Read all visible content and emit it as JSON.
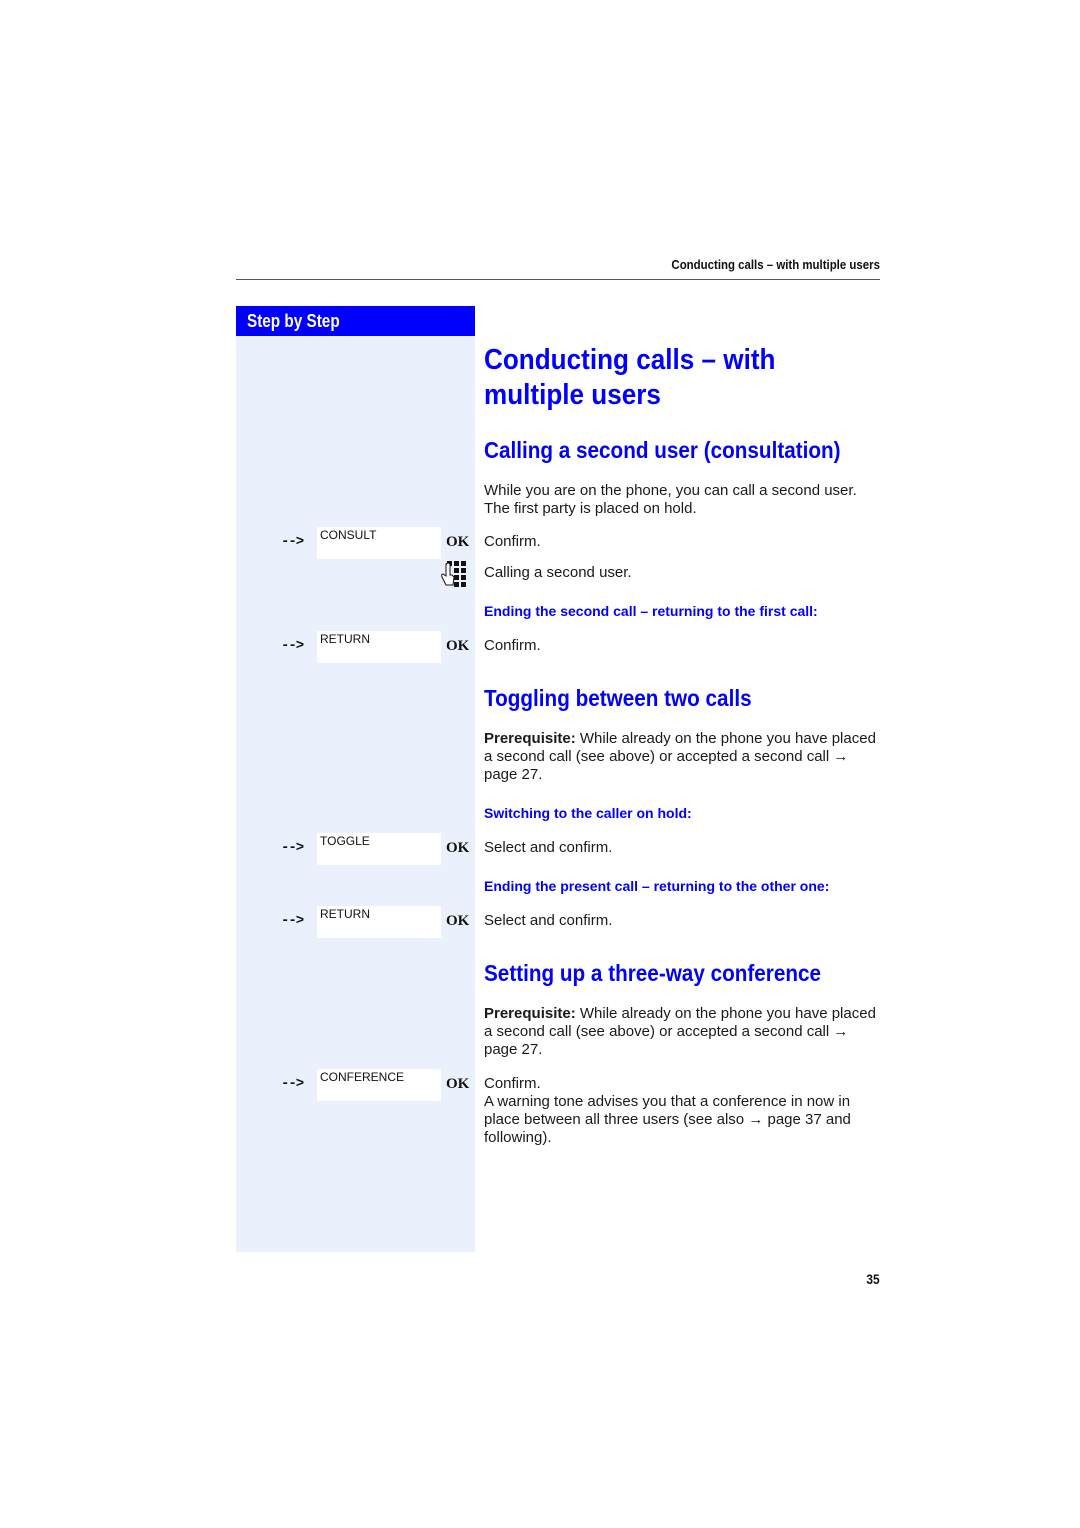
{
  "header": {
    "running_title": "Conducting calls – with multiple users"
  },
  "sidebar": {
    "title": "Step by Step"
  },
  "main": {
    "title": "Conducting calls – with multiple users",
    "sections": [
      {
        "heading": "Calling a second user (consultation)",
        "intro": "While you are on the phone, you can call a second user. The first party is placed on hold.",
        "steps": [
          {
            "arrow": "-->",
            "softkey": "CONSULT",
            "key": "OK",
            "text": "Confirm."
          },
          {
            "icon": "keypad-icon",
            "text": "Calling a second user."
          }
        ],
        "subheading": "Ending the second call – returning to the first call:",
        "sub_steps": [
          {
            "arrow": "-->",
            "softkey": "RETURN",
            "key": "OK",
            "text": "Confirm."
          }
        ]
      },
      {
        "heading": "Toggling between two calls",
        "prereq_label": "Prerequisite:",
        "prereq_text": " While already on the phone you have placed a second call (see above) or accepted a second call → page 27.",
        "subheading1": "Switching to the caller on hold:",
        "steps1": [
          {
            "arrow": "-->",
            "softkey": "TOGGLE",
            "key": "OK",
            "text": "Select and confirm."
          }
        ],
        "subheading2": "Ending the present call – returning to the other one:",
        "steps2": [
          {
            "arrow": "-->",
            "softkey": "RETURN",
            "key": "OK",
            "text": "Select and confirm."
          }
        ]
      },
      {
        "heading": "Setting up a three-way conference",
        "prereq_label": "Prerequisite:",
        "prereq_text": " While already on the phone you have placed a second call (see above) or accepted a second call → page 27.",
        "steps": [
          {
            "arrow": "-->",
            "softkey": "CONFERENCE",
            "key": "OK",
            "text": "Confirm.",
            "note": "A warning tone advises you that a conference in now in place between all three users (see also → page 37 and following)."
          }
        ]
      }
    ]
  },
  "footer": {
    "page_number": "35"
  }
}
